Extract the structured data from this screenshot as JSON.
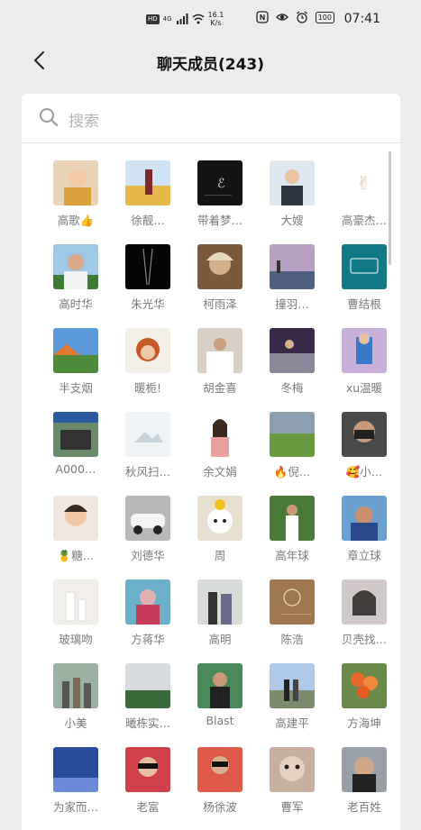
{
  "status": {
    "hd": "HD",
    "net": "4G",
    "speed_value": "16.1",
    "speed_unit": "K/s",
    "battery": "100",
    "time": "07:41"
  },
  "header": {
    "title": "聊天成员(243)"
  },
  "search": {
    "placeholder": "搜索"
  },
  "members": [
    {
      "name": "高歌👍"
    },
    {
      "name": "徐靓…"
    },
    {
      "name": "带着梦…"
    },
    {
      "name": "大嫂"
    },
    {
      "name": "高豪杰…"
    },
    {
      "name": "高时华"
    },
    {
      "name": "朱光华"
    },
    {
      "name": "柯雨泽"
    },
    {
      "name": "撞羽…"
    },
    {
      "name": "曹结根"
    },
    {
      "name": "半支烟"
    },
    {
      "name": "暖栀!"
    },
    {
      "name": "胡金喜"
    },
    {
      "name": "冬梅"
    },
    {
      "name": "xu温暖"
    },
    {
      "name": "A000…"
    },
    {
      "name": "秋风扫…"
    },
    {
      "name": "余文娟"
    },
    {
      "name": "🔥倪…"
    },
    {
      "name": "🥰小…"
    },
    {
      "name": "🍍糖…"
    },
    {
      "name": "刘德华"
    },
    {
      "name": "周"
    },
    {
      "name": "高年球"
    },
    {
      "name": "章立球"
    },
    {
      "name": "玻璃吻"
    },
    {
      "name": "方蒋华"
    },
    {
      "name": "高明"
    },
    {
      "name": "陈浩"
    },
    {
      "name": "贝壳找…"
    },
    {
      "name": "小美"
    },
    {
      "name": "曦栋实…"
    },
    {
      "name": "Blast"
    },
    {
      "name": "高建平"
    },
    {
      "name": "方海坤"
    },
    {
      "name": "为家而…"
    },
    {
      "name": "老富"
    },
    {
      "name": "杨徐波"
    },
    {
      "name": "曹军"
    },
    {
      "name": "老百姓"
    }
  ],
  "avatar_tile_texts": {
    "t2": "记忆旅行",
    "t3": "普龙汽车修理中心",
    "t4": "留住美好"
  }
}
